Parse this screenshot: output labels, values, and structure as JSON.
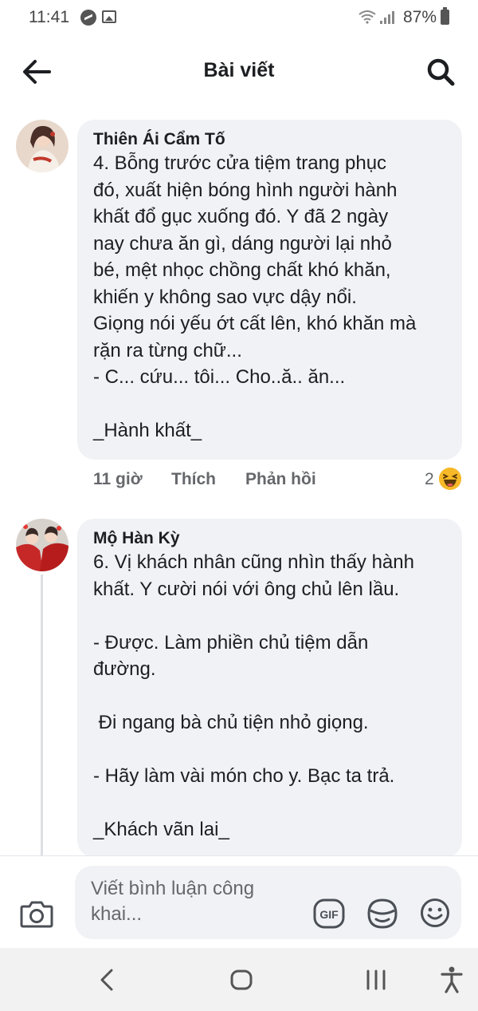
{
  "status_bar": {
    "time": "11:41",
    "battery": "87%",
    "icons": [
      "messenger-icon",
      "image-icon",
      "wifi-icon",
      "signal-icon",
      "battery-icon"
    ]
  },
  "header": {
    "title": "Bài viết",
    "back_icon": "arrow-left-icon",
    "search_icon": "search-icon"
  },
  "comments": [
    {
      "author": "Thiên Ái Cẩm Tố",
      "text": "4. Bỗng trước cửa tiệm trang phục\nđó, xuất hiện bóng hình người hành\nkhất đổ gục xuống đó. Y đã 2 ngày\nnay chưa ăn gì, dáng người lại nhỏ\nbé, mệt nhọc chồng chất khó khăn,\nkhiến y không sao vực dậy nổi.\nGiọng nói yếu ớt cất lên, khó khăn mà\nrặn ra từng chữ...\n- C... cứu... tôi... Cho..ă.. ăn...\n\n_Hành khất_",
      "time": "11 giờ",
      "like_label": "Thích",
      "reply_label": "Phản hồi",
      "reaction_count": "2",
      "reaction_icon": "haha-emoji-icon"
    },
    {
      "author": "Mộ Hàn Kỳ",
      "text": "6. Vị khách nhân cũng nhìn thấy hành\nkhất. Y cười nói với ông chủ lên lầu.\n\n- Được. Làm phiền chủ tiệm dẫn\nđường.\n\n Đi ngang bà chủ tiện nhỏ giọng.\n\n- Hãy làm vài món cho y. Bạc ta trả.\n\n_Khách vãn lai_"
    }
  ],
  "composer": {
    "placeholder": "Viết bình luận công khai...",
    "icons": [
      "camera-icon",
      "gif-icon",
      "sticker-icon",
      "emoji-icon"
    ]
  },
  "nav_bar": {
    "icons": [
      "back-nav-icon",
      "home-nav-icon",
      "recents-nav-icon",
      "accessibility-icon"
    ]
  }
}
